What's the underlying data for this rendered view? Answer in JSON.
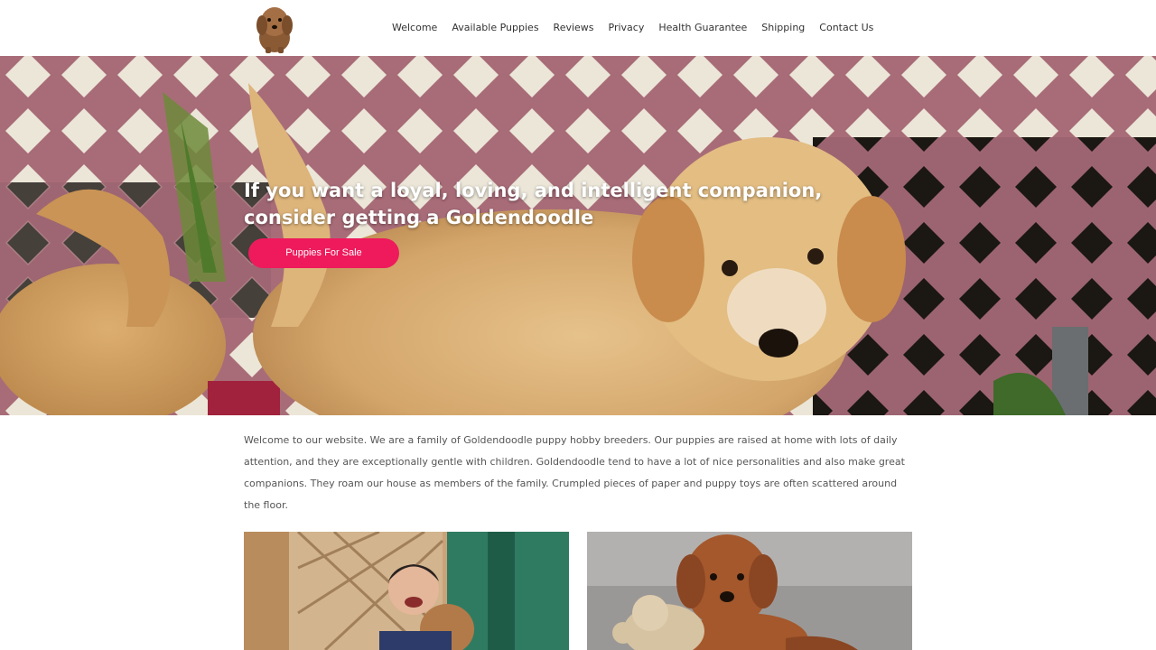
{
  "header": {
    "logo_icon": "goldendoodle-puppy-logo",
    "nav": [
      {
        "label": "Welcome"
      },
      {
        "label": "Available Puppies"
      },
      {
        "label": "Reviews"
      },
      {
        "label": "Privacy"
      },
      {
        "label": "Health Guarantee"
      },
      {
        "label": "Shipping"
      },
      {
        "label": "Contact Us"
      }
    ]
  },
  "hero": {
    "headline": "If you want a loyal, loving, and intelligent companion, consider getting a Goldendoodle",
    "cta_label": "Puppies For Sale",
    "cta_color": "#ee1a5c"
  },
  "intro": {
    "text": "Welcome to our website. We are a family of Goldendoodle puppy hobby breeders. Our puppies are raised at home with lots of daily attention, and they are exceptionally gentle with children. Goldendoodle tend to have a lot of nice personalities and also make great companions. They roam our house as members of the family. Crumpled pieces of paper and puppy toys are often scattered around the floor."
  },
  "photos": [
    {
      "name": "child-with-puppy-photo"
    },
    {
      "name": "puppy-with-teddy-photo"
    }
  ]
}
